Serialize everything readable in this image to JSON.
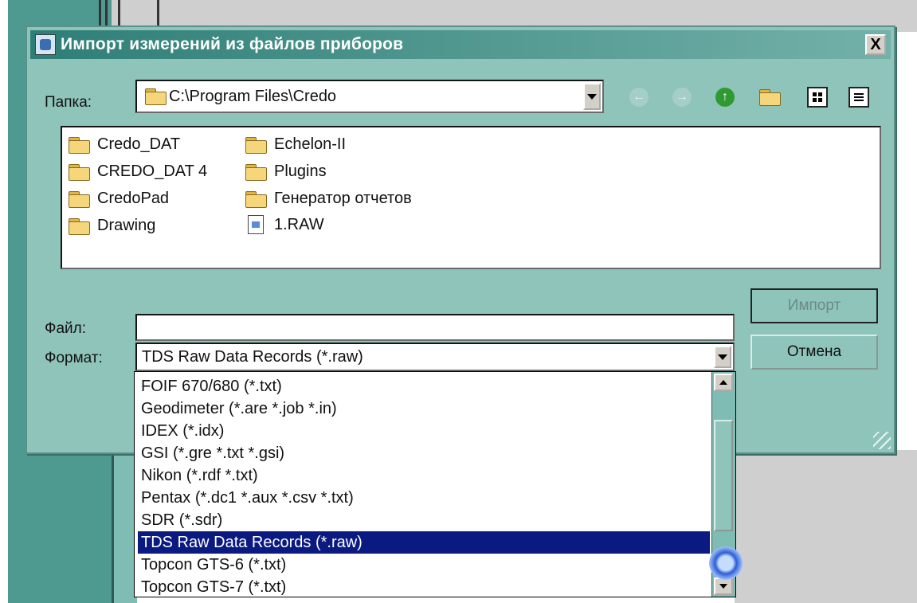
{
  "dialog": {
    "title": "Импорт измерений из файлов приборов",
    "close_label": "X"
  },
  "folder": {
    "label": "Папка:",
    "path": "C:\\Program Files\\Credo"
  },
  "toolbar": {
    "icons": [
      "back-icon",
      "forward-icon",
      "up-folder-icon",
      "new-folder-icon",
      "list-view-icon",
      "details-view-icon"
    ]
  },
  "files": [
    {
      "name": "Credo_DAT",
      "kind": "folder"
    },
    {
      "name": "CREDO_DAT 4",
      "kind": "folder"
    },
    {
      "name": "CredoPad",
      "kind": "folder"
    },
    {
      "name": "Drawing",
      "kind": "folder"
    },
    {
      "name": "Echelon-II",
      "kind": "folder"
    },
    {
      "name": "Plugins",
      "kind": "folder"
    },
    {
      "name": "Генератор отчетов",
      "kind": "folder"
    },
    {
      "name": "1.RAW",
      "kind": "file"
    }
  ],
  "file_field": {
    "label": "Файл:",
    "value": ""
  },
  "format": {
    "label": "Формат:",
    "selected": "TDS Raw Data Records (*.raw)",
    "options": [
      "FOIF 670/680 (*.txt)",
      "Geodimeter (*.are *.job *.in)",
      "IDEX (*.idx)",
      "GSI (*.gre *.txt *.gsi)",
      "Nikon (*.rdf *.txt)",
      "Pentax (*.dc1 *.aux *.csv *.txt)",
      "SDR (*.sdr)",
      "TDS Raw Data Records (*.raw)",
      "Topcon GTS-6 (*.txt)",
      "Topcon GTS-7 (*.txt)"
    ]
  },
  "buttons": {
    "import_label": "Импорт",
    "cancel_label": "Отмена"
  }
}
